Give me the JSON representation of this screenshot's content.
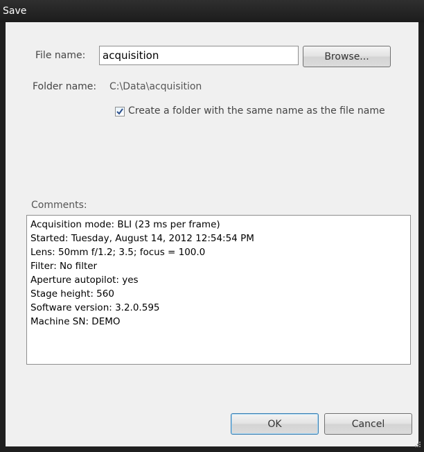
{
  "window": {
    "title": "Save"
  },
  "form": {
    "file_name_label": "File name:",
    "file_name_value": "acquisition",
    "browse_label": "Browse...",
    "folder_name_label": "Folder name:",
    "folder_name_value": "C:\\Data\\acquisition",
    "create_folder_label": "Create a folder with the same name as the file name",
    "create_folder_checked": true,
    "comments_label": "Comments:",
    "comments_value": "Acquisition mode: BLI (23 ms per frame)\nStarted: Tuesday, August 14, 2012 12:54:54 PM\nLens: 50mm f/1.2; 3.5; focus = 100.0\nFilter: No filter\nAperture autopilot: yes\nStage height: 560\nSoftware version: 3.2.0.595\nMachine SN: DEMO"
  },
  "buttons": {
    "ok_label": "OK",
    "cancel_label": "Cancel"
  },
  "colors": {
    "titlebar": "#1c1c1c",
    "client_background": "#f0f0f0",
    "checkmark": "#2b4f8c"
  }
}
